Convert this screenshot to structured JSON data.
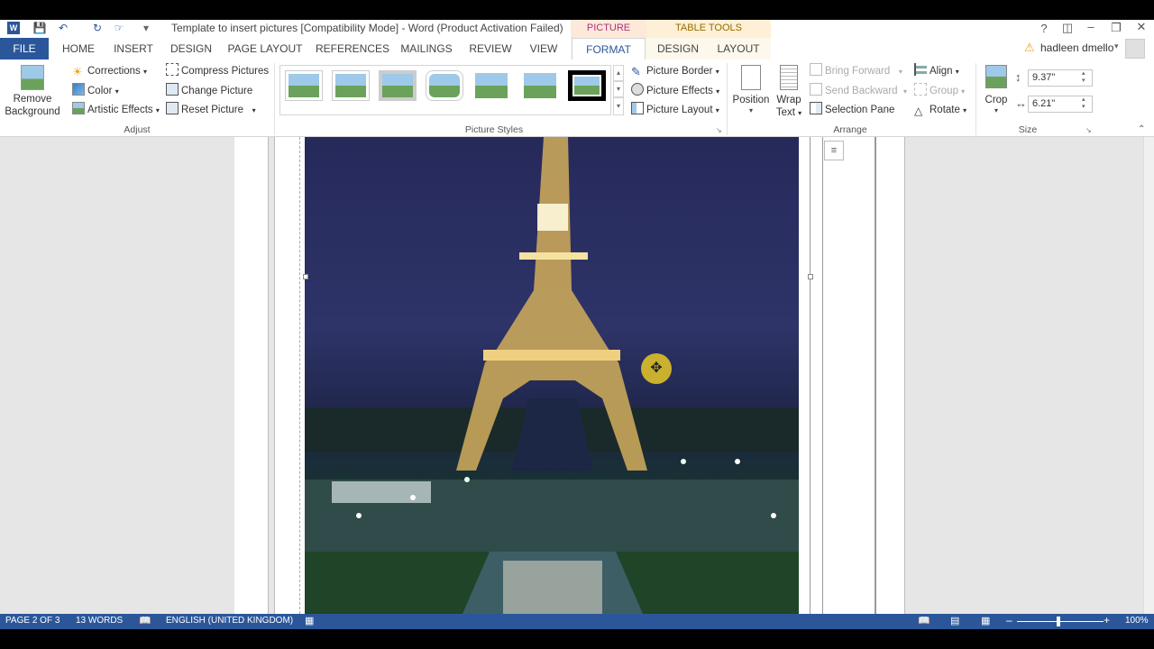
{
  "window": {
    "title": "Template to insert pictures [Compatibility Mode] - Word (Product Activation Failed)",
    "context_picture_tools": "PICTURE TOOLS",
    "context_table_tools": "TABLE TOOLS",
    "help": "?"
  },
  "tabs": {
    "file": "FILE",
    "home": "HOME",
    "insert": "INSERT",
    "design": "DESIGN",
    "page_layout": "PAGE LAYOUT",
    "references": "REFERENCES",
    "mailings": "MAILINGS",
    "review": "REVIEW",
    "view": "VIEW",
    "format": "FORMAT",
    "table_design": "DESIGN",
    "table_layout": "LAYOUT"
  },
  "user": {
    "name": "hadleen dmello"
  },
  "ribbon": {
    "remove_bg_line1": "Remove",
    "remove_bg_line2": "Background",
    "corrections": "Corrections",
    "color": "Color",
    "artistic_effects": "Artistic Effects",
    "compress_pictures": "Compress Pictures",
    "change_picture": "Change Picture",
    "reset_picture": "Reset Picture",
    "adjust_group": "Adjust",
    "picture_styles_group": "Picture Styles",
    "picture_border": "Picture Border",
    "picture_effects": "Picture Effects",
    "picture_layout": "Picture Layout",
    "position": "Position",
    "wrap_text_line1": "Wrap",
    "wrap_text_line2": "Text",
    "bring_forward": "Bring Forward",
    "send_backward": "Send Backward",
    "selection_pane": "Selection Pane",
    "align": "Align",
    "group": "Group",
    "rotate": "Rotate",
    "arrange_group": "Arrange",
    "crop": "Crop",
    "height": "9.37\"",
    "width": "6.21\"",
    "size_group": "Size"
  },
  "status": {
    "page": "PAGE 2 OF 3",
    "words": "13 WORDS",
    "language": "ENGLISH (UNITED KINGDOM)",
    "zoom": "100%"
  },
  "colors": {
    "accent": "#2b579a",
    "context_tab": "#fde9d9"
  }
}
